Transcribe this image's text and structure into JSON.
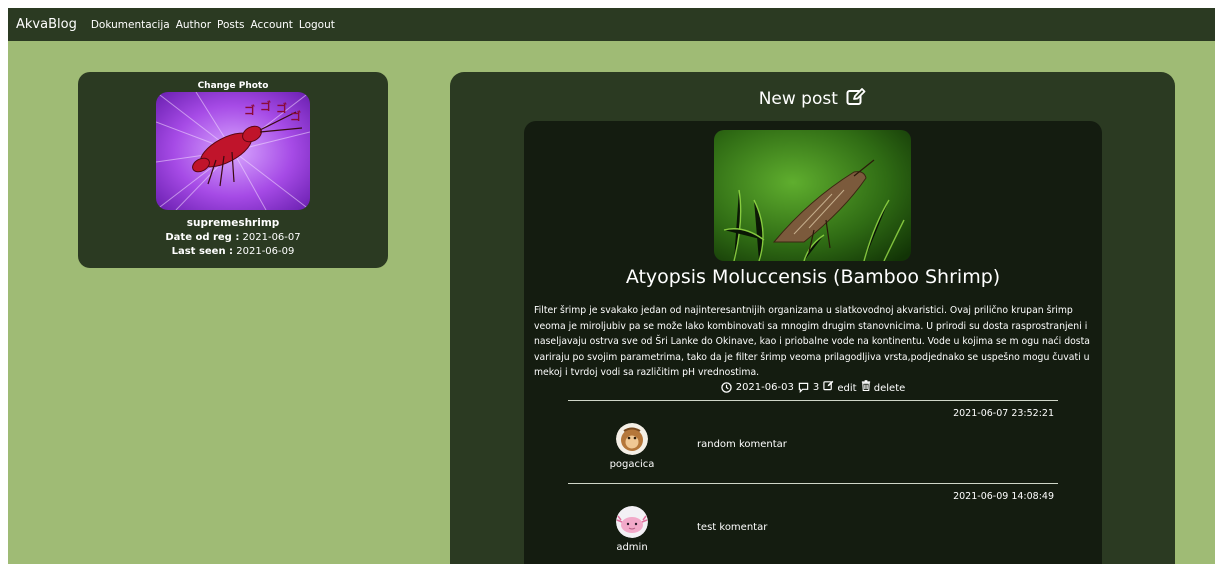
{
  "navbar": {
    "brand": "AkvaBlog",
    "links": [
      "Dokumentacija",
      "Author",
      "Posts",
      "Account",
      "Logout"
    ]
  },
  "profile": {
    "change_photo": "Change Photo",
    "username": "supremeshrimp",
    "date_reg_label": "Date od reg :",
    "date_reg_value": "2021-06-07",
    "last_seen_label": "Last seen :",
    "last_seen_value": "2021-06-09"
  },
  "new_post": {
    "label": "New post",
    "icon": "edit-icon"
  },
  "post": {
    "title": "Atyopsis Moluccensis (Bamboo Shrimp)",
    "body": "Filter šrimp je svakako jedan od najinteresantnijih organizama u slatkovodnoj akvaristici. Ovaj prilično krupan šrimp veoma je miroljubiv pa se može lako kombinovati sa mnogim drugim stanovnicima. U prirodi su dosta rasprostranjeni i naseljavaju ostrva sve od Šri Lanke do Okinave, kao i priobalne vode na kontinentu. Vode u kojima se m ogu naći dosta variraju po svojim parametrima, tako da je filter šrimp veoma prilagodljiva vrsta,podjednako se uspešno mogu čuvati u mekoj i tvrdoj vodi sa različitim pH vrednostima.",
    "date": "2021-06-03",
    "comment_count": "3",
    "edit_label": "edit",
    "delete_label": "delete"
  },
  "comments": [
    {
      "time": "2021-06-07 23:52:21",
      "user": "pogacica",
      "text": "random komentar"
    },
    {
      "time": "2021-06-09 14:08:49",
      "user": "admin",
      "text": "test komentar"
    }
  ],
  "colors": {
    "page_bg": "#9fbb75",
    "panel_bg": "#2b3a22",
    "card_bg": "#141c10"
  }
}
